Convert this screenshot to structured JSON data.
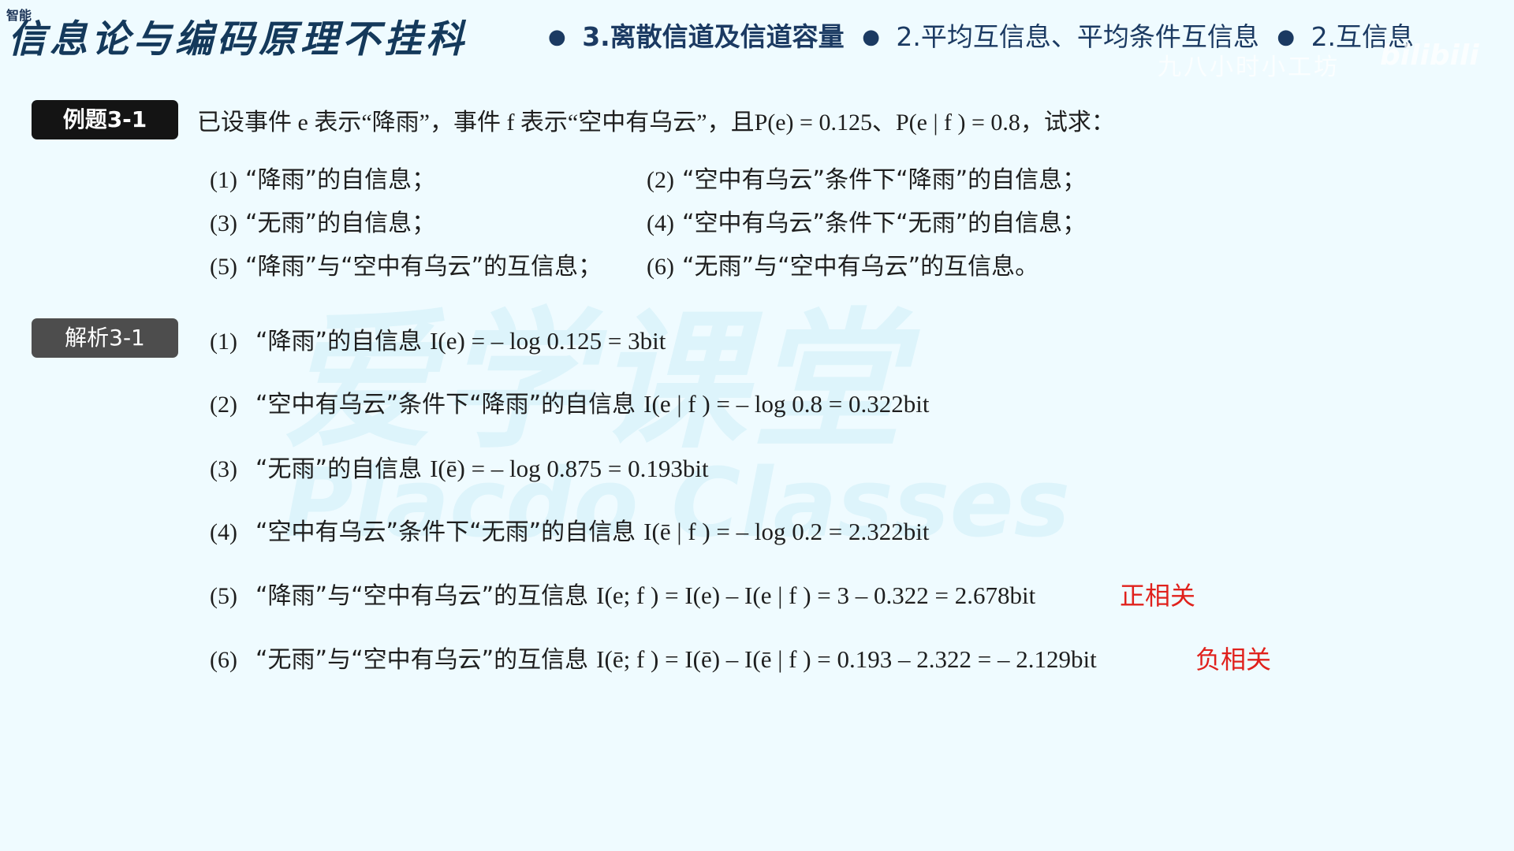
{
  "header": {
    "tag": "智能",
    "course_title": "信息论与编码原理不挂科",
    "breadcrumb": [
      "3.离散信道及信道容量",
      "2.平均互信息、平均条件互信息",
      "2.互信息"
    ],
    "watermark_text": "九八小时小工坊",
    "logo_text": "bilibili"
  },
  "background_watermark": {
    "main": "爱学课堂",
    "sub": "Placdo Classes"
  },
  "example": {
    "label": "例题3-1",
    "statement": "已设事件 e 表示“降雨”，事件 f 表示“空中有乌云”，且P(e) = 0.125、P(e | f ) = 0.8，试求：",
    "questions": [
      {
        "num": "(1)",
        "text": "“降雨”的自信息；"
      },
      {
        "num": "(2)",
        "text": "“空中有乌云”条件下“降雨”的自信息；"
      },
      {
        "num": "(3)",
        "text": "“无雨”的自信息；"
      },
      {
        "num": "(4)",
        "text": "“空中有乌云”条件下“无雨”的自信息；"
      },
      {
        "num": "(5)",
        "text": "“降雨”与“空中有乌云”的互信息；"
      },
      {
        "num": "(6)",
        "text": "“无雨”与“空中有乌云”的互信息。"
      }
    ]
  },
  "analysis": {
    "label": "解析3-1",
    "items": [
      {
        "num": "(1)",
        "text": "“降雨”的自信息",
        "formula": "I(e) = – log 0.125 = 3bit"
      },
      {
        "num": "(2)",
        "text": "“空中有乌云”条件下“降雨”的自信息",
        "formula": "I(e | f ) = – log 0.8 = 0.322bit"
      },
      {
        "num": "(3)",
        "text": "“无雨”的自信息",
        "formula": "I(ē) = – log 0.875 = 0.193bit"
      },
      {
        "num": "(4)",
        "text": "“空中有乌云”条件下“无雨”的自信息",
        "formula": "I(ē | f ) = – log 0.2 = 2.322bit"
      },
      {
        "num": "(5)",
        "text": "“降雨”与“空中有乌云”的互信息",
        "formula": "I(e; f ) = I(e) – I(e | f ) = 3 – 0.322 = 2.678bit",
        "note": "正相关"
      },
      {
        "num": "(6)",
        "text": "“无雨”与“空中有乌云”的互信息",
        "formula": "I(ē; f ) = I(ē) – I(ē | f ) = 0.193 – 2.322 = – 2.129bit",
        "note": "负相关"
      }
    ]
  },
  "colors": {
    "background": "#effbff",
    "title": "#14395b",
    "note": "#e0211c",
    "example_label_bg": "#141414",
    "analysis_label_bg": "#4d4d4d"
  }
}
